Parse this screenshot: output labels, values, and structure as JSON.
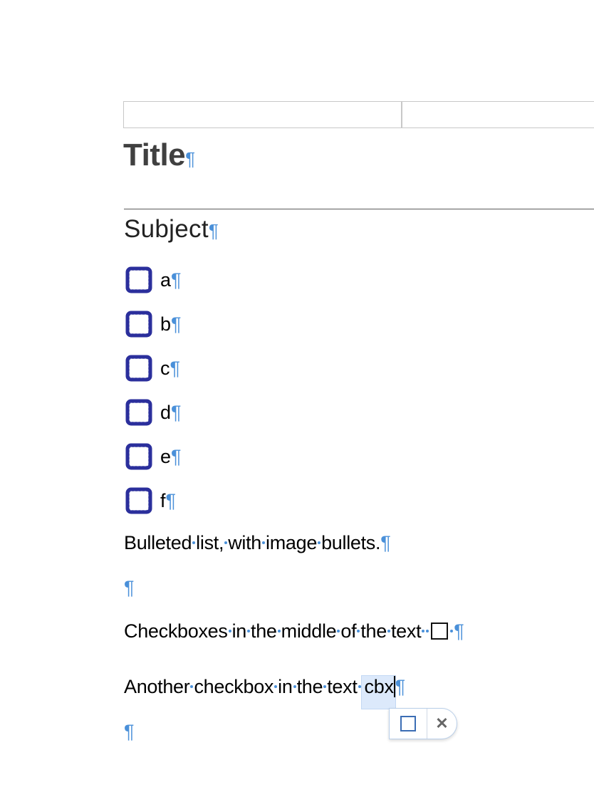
{
  "header": {
    "title": "Title",
    "subject": "Subject"
  },
  "pilcrow": "¶",
  "checklist": {
    "items": [
      {
        "label": "a"
      },
      {
        "label": "b"
      },
      {
        "label": "c"
      },
      {
        "label": "d"
      },
      {
        "label": "e"
      },
      {
        "label": "f"
      }
    ]
  },
  "paragraphs": {
    "bulleted": [
      "Bulleted",
      "list,",
      "with",
      "image",
      "bullets."
    ],
    "checkboxes": [
      "Checkboxes",
      "in",
      "the",
      "middle",
      "of",
      "the",
      "text"
    ],
    "another": [
      "Another",
      "checkbox",
      "in",
      "the",
      "text"
    ],
    "selected_text": "cbx"
  },
  "popover": {
    "checkbox_icon": "checkbox-icon",
    "close_glyph": "✕"
  },
  "colors": {
    "pilcrow": "#4a90d9",
    "bullet_ink": "#2b2f9c",
    "selection": "#dce9fb"
  }
}
